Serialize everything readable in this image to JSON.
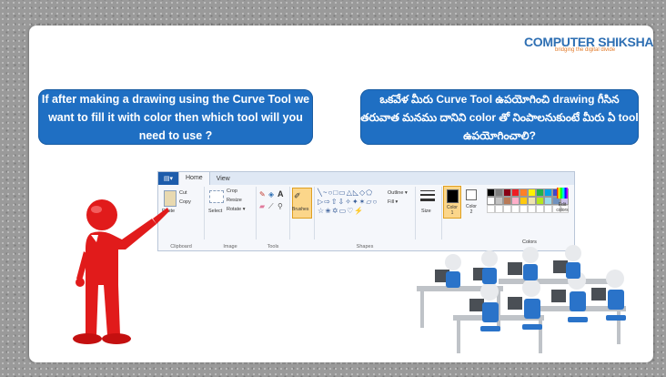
{
  "logo": {
    "name": "COMPUTER SHIKSHA",
    "tagline": "bridging the digital divide"
  },
  "question_en": "If after making a drawing using the Curve Tool we want to fill it with color then which tool will you need to use ?",
  "question_te": "ఒకవేళ మీరు Curve Tool ఉపయోగించి drawing గీసిన తరువాత మనము దానిని color తో నింపాలనుకుంటే మీరు ఏ tool ఉపయోగించాలి?",
  "ribbon": {
    "tabs": [
      "Home",
      "View"
    ],
    "clipboard": {
      "paste": "Paste",
      "cut": "Cut",
      "copy": "Copy",
      "label": "Clipboard"
    },
    "image": {
      "select": "Select",
      "crop": "Crop",
      "resize": "Resize",
      "rotate": "Rotate ▾",
      "label": "Image"
    },
    "tools": {
      "label": "Tools"
    },
    "brushes": "Brushes",
    "shapes": {
      "outline": "Outline ▾",
      "fill": "Fill ▾",
      "label": "Shapes"
    },
    "size": "Size",
    "color1": "Color 1",
    "color2": "Color 2",
    "colors_label": "Colors",
    "edit_colors": "Edit colors",
    "palette_colors": [
      "#000000",
      "#7f7f7f",
      "#880015",
      "#ed1c24",
      "#ff7f27",
      "#fff200",
      "#22b14c",
      "#00a2e8",
      "#3f48cc",
      "#a349a4",
      "#ffffff",
      "#c3c3c3",
      "#b97a57",
      "#ffaec9",
      "#ffc90e",
      "#efe4b0",
      "#b5e61d",
      "#99d9ea",
      "#7092be",
      "#c8bfe7"
    ]
  },
  "colors": {
    "bubble": "#1f6fc3",
    "figure": "#e11b1b",
    "accent": "#2e6fb3"
  }
}
